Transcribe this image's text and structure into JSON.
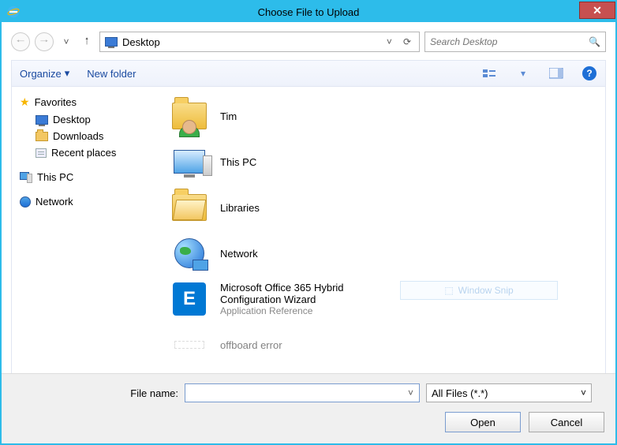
{
  "window": {
    "title": "Choose File to Upload"
  },
  "address": {
    "location": "Desktop"
  },
  "search": {
    "placeholder": "Search Desktop"
  },
  "toolbar": {
    "organize": "Organize",
    "newfolder": "New folder"
  },
  "sidebar": {
    "fav_header": "Favorites",
    "fav": [
      "Desktop",
      "Downloads",
      "Recent places"
    ],
    "thispc": "This PC",
    "network": "Network"
  },
  "items": [
    {
      "title": "Tim",
      "sub": ""
    },
    {
      "title": "This PC",
      "sub": ""
    },
    {
      "title": "Libraries",
      "sub": ""
    },
    {
      "title": "Network",
      "sub": ""
    },
    {
      "title": "Microsoft Office 365 Hybrid Configuration Wizard",
      "sub": "Application Reference"
    },
    {
      "title": "offboard error",
      "sub": ""
    }
  ],
  "ghost": {
    "label": "Window Snip"
  },
  "footer": {
    "filename_label": "File name:",
    "filename_value": "",
    "filter": "All Files (*.*)",
    "open": "Open",
    "cancel": "Cancel"
  }
}
